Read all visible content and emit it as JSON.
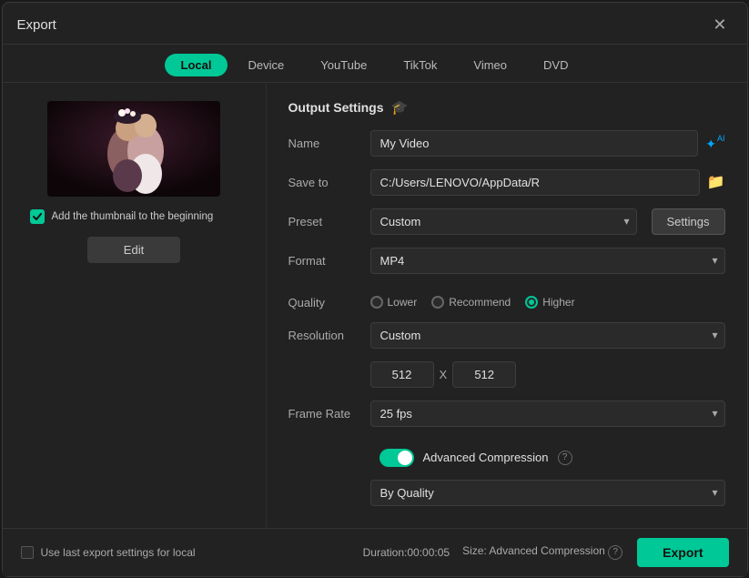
{
  "dialog": {
    "title": "Export",
    "close_label": "✕"
  },
  "tabs": {
    "items": [
      {
        "label": "Local",
        "active": true
      },
      {
        "label": "Device",
        "active": false
      },
      {
        "label": "YouTube",
        "active": false
      },
      {
        "label": "TikTok",
        "active": false
      },
      {
        "label": "Vimeo",
        "active": false
      },
      {
        "label": "DVD",
        "active": false
      }
    ]
  },
  "left_panel": {
    "checkbox_label": "Add the thumbnail to the beginning",
    "edit_label": "Edit"
  },
  "output_settings": {
    "section_title": "Output Settings",
    "name_label": "Name",
    "name_value": "My Video",
    "save_to_label": "Save to",
    "save_to_value": "C:/Users/LENOVO/AppData/R",
    "preset_label": "Preset",
    "preset_value": "Custom",
    "settings_label": "Settings",
    "format_label": "Format",
    "format_value": "MP4",
    "quality_label": "Quality",
    "quality_options": [
      {
        "label": "Lower",
        "selected": false
      },
      {
        "label": "Recommend",
        "selected": false
      },
      {
        "label": "Higher",
        "selected": true
      }
    ],
    "resolution_label": "Resolution",
    "resolution_value": "Custom",
    "res_width": "512",
    "res_x_label": "X",
    "res_height": "512",
    "frame_rate_label": "Frame Rate",
    "frame_rate_value": "25 fps",
    "advanced_compression_label": "Advanced Compression",
    "by_quality_value": "By Quality"
  },
  "footer": {
    "use_last_settings_label": "Use last export settings for local",
    "duration_label": "Duration:",
    "duration_value": "00:00:05",
    "size_label": "Size: Advanced Compression",
    "export_label": "Export"
  },
  "icons": {
    "info": "🎓",
    "ai": "✦",
    "folder": "📁",
    "help": "?"
  }
}
